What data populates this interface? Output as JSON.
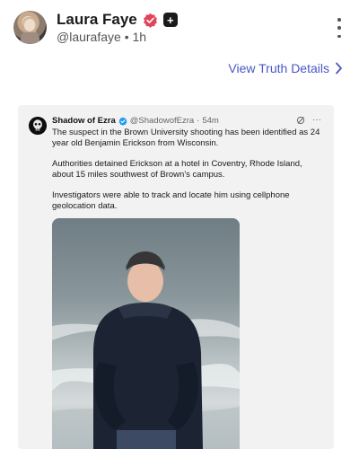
{
  "post": {
    "display_name": "Laura Faye",
    "handle": "@laurafaye",
    "separator": "•",
    "time": "1h",
    "more_icon": "vertical-ellipsis-icon"
  },
  "truth_details": {
    "label": "View Truth Details",
    "icon": "chevron-right-icon"
  },
  "embed": {
    "author": "Shadow of Ezra",
    "handle": "@ShadowofEzra",
    "separator": "·",
    "time": "54m",
    "paragraphs": [
      "The suspect in the Brown University shooting has been identified as 24 year old Benjamin Erickson from Wisconsin.",
      "Authorities detained Erickson at a hotel in Coventry, Rhode Island, about 15 miles southwest of Brown's campus.",
      "Investigators were able to track and locate him using cellphone geolocation data."
    ],
    "tool_icons": [
      "grok-icon",
      "more-horizontal-icon"
    ],
    "more_label": "···"
  },
  "colors": {
    "accent": "#4a55c8",
    "verified": "#e0445a",
    "tw_verified": "#1d9bf0",
    "card_bg": "#f2f2f2"
  }
}
